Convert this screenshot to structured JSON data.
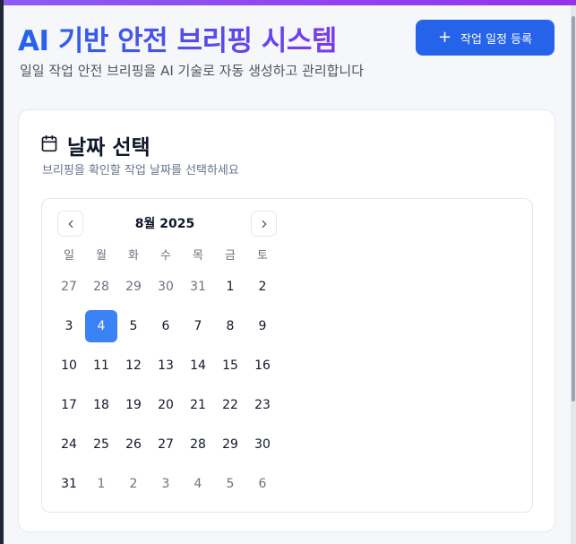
{
  "header": {
    "title": "AI 기반 안전 브리핑 시스템",
    "subtitle": "일일 작업 안전 브리핑을 AI 기술로 자동 생성하고 관리합니다",
    "add_button": {
      "icon": "plus-icon",
      "label": "작업 일정 등록"
    }
  },
  "date_card": {
    "icon": "calendar-icon",
    "title": "날짜 선택",
    "description": "브리핑을 확인할 작업 날짜를 선택하세요"
  },
  "calendar": {
    "month_label": "8월 2025",
    "prev_icon": "chevron-left-icon",
    "next_icon": "chevron-right-icon",
    "weekdays": [
      "일",
      "월",
      "화",
      "수",
      "목",
      "금",
      "토"
    ],
    "weeks": [
      [
        "27",
        "28",
        "29",
        "30",
        "31",
        "1",
        "2"
      ],
      [
        "3",
        "4",
        "5",
        "6",
        "7",
        "8",
        "9"
      ],
      [
        "10",
        "11",
        "12",
        "13",
        "14",
        "15",
        "16"
      ],
      [
        "17",
        "18",
        "19",
        "20",
        "21",
        "22",
        "23"
      ],
      [
        "24",
        "25",
        "26",
        "27",
        "28",
        "29",
        "30"
      ],
      [
        "31",
        "1",
        "2",
        "3",
        "4",
        "5",
        "6"
      ]
    ],
    "selected_day": "4",
    "colors": {
      "selected": "#3b82f6",
      "accent": "#2563eb"
    }
  }
}
